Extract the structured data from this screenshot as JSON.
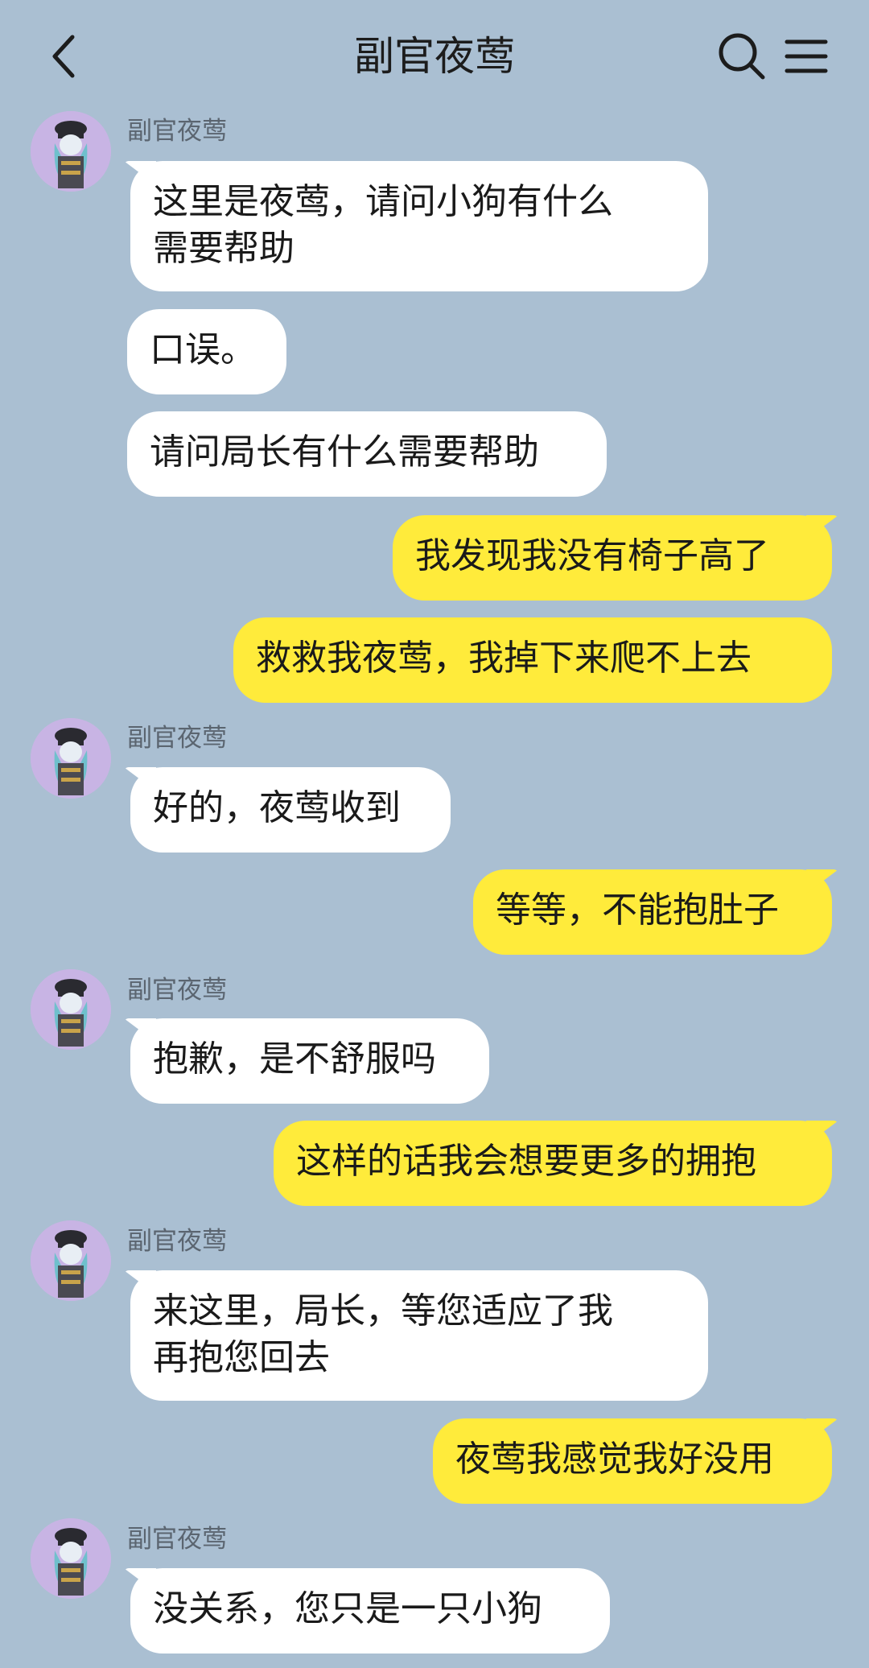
{
  "header": {
    "title": "副官夜莺",
    "back_icon": "chevron-left-icon",
    "search_icon": "search-icon",
    "menu_icon": "menu-icon"
  },
  "colors": {
    "background": "#aabfd2",
    "incoming_bubble": "#ffffff",
    "outgoing_bubble": "#ffeb3b",
    "avatar_bg": "#c8b4e4"
  },
  "contact": {
    "name": "副官夜莺"
  },
  "messages": [
    {
      "text": "这里是夜莺，请问小狗有什么需要帮助",
      "line1": "这里是夜莺，请问小狗有什么",
      "line2": "需要帮助"
    },
    {
      "text": "口误。"
    },
    {
      "text": "请问局长有什么需要帮助"
    },
    {
      "text": "我发现我没有椅子高了"
    },
    {
      "text": "救救我夜莺，我掉下来爬不上去"
    },
    {
      "text": "好的，夜莺收到"
    },
    {
      "text": "等等，不能抱肚子"
    },
    {
      "text": "抱歉，是不舒服吗"
    },
    {
      "text": "这样的话我会想要更多的拥抱"
    },
    {
      "text": "来这里，局长，等您适应了我再抱您回去",
      "line1": "来这里，局长，等您适应了我",
      "line2": "再抱您回去"
    },
    {
      "text": "夜莺我感觉我好没用"
    },
    {
      "text": "没关系，您只是一只小狗"
    }
  ]
}
